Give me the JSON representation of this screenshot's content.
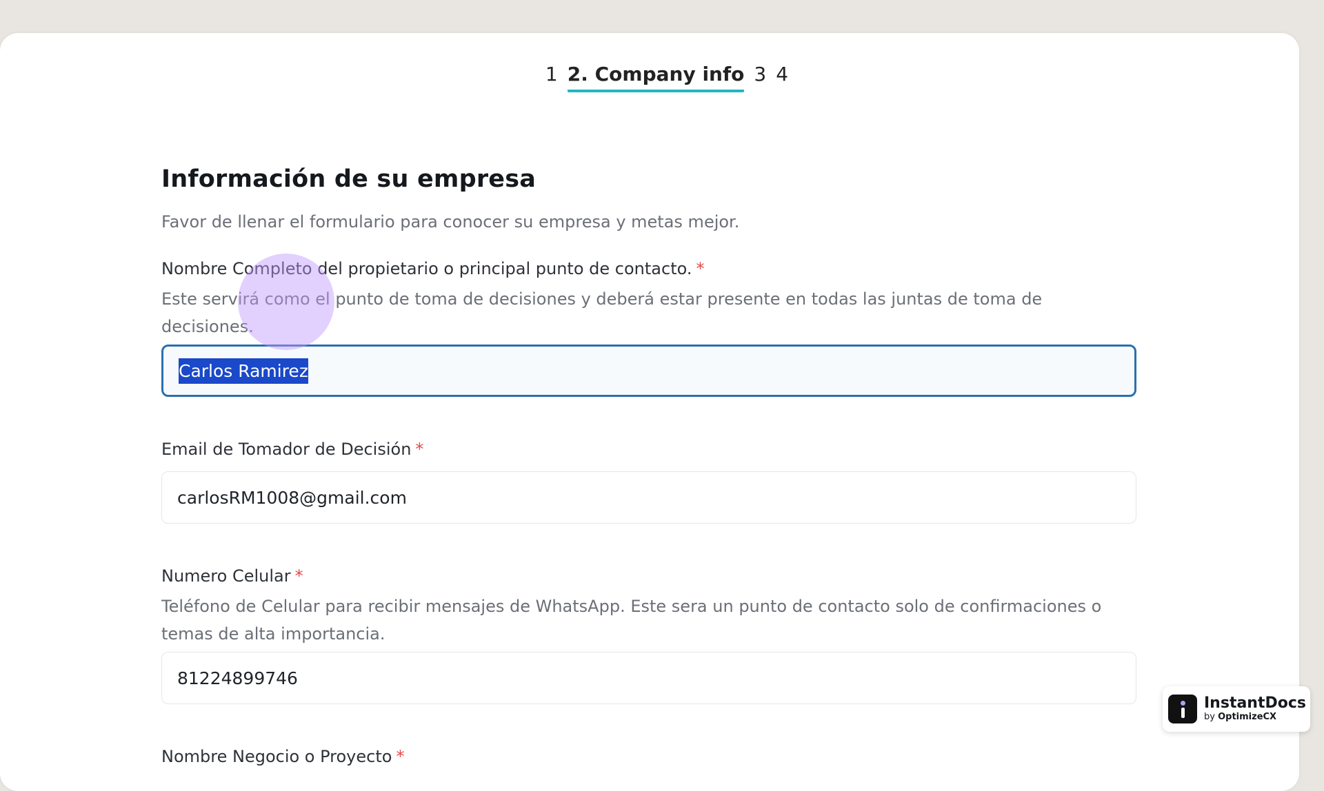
{
  "stepper": {
    "steps": [
      "1",
      "2. Company info",
      "3",
      "4"
    ]
  },
  "section": {
    "title": "Información de su empresa",
    "subtitle": "Favor de llenar el formulario para conocer su empresa y metas mejor."
  },
  "fields": [
    {
      "label": "Nombre Completo del propietario o principal punto de contacto.",
      "required_mark": "*",
      "help": "Este servirá como el punto de toma de decisiones y deberá estar presente en todas las juntas de toma de decisiones.",
      "value": "Carlos Ramirez"
    },
    {
      "label": "Email de Tomador de Decisión",
      "required_mark": "*",
      "value": "carlosRM1008@gmail.com"
    },
    {
      "label": "Numero Celular",
      "required_mark": "*",
      "help": "Teléfono de Celular para recibir mensajes de WhatsApp. Este sera un punto de contacto solo de confirmaciones o temas de alta importancia.",
      "value": "81224899746"
    },
    {
      "label": "Nombre Negocio o Proyecto",
      "required_mark": "*"
    }
  ],
  "brand": {
    "name": "InstantDocs",
    "by_prefix": "by",
    "by_name": "OptimizeCX"
  },
  "colors": {
    "accent_underline": "#1fb7c2",
    "focus_border": "#2a6fb0",
    "selection": "#1a49c9",
    "required": "#e04a4a"
  }
}
